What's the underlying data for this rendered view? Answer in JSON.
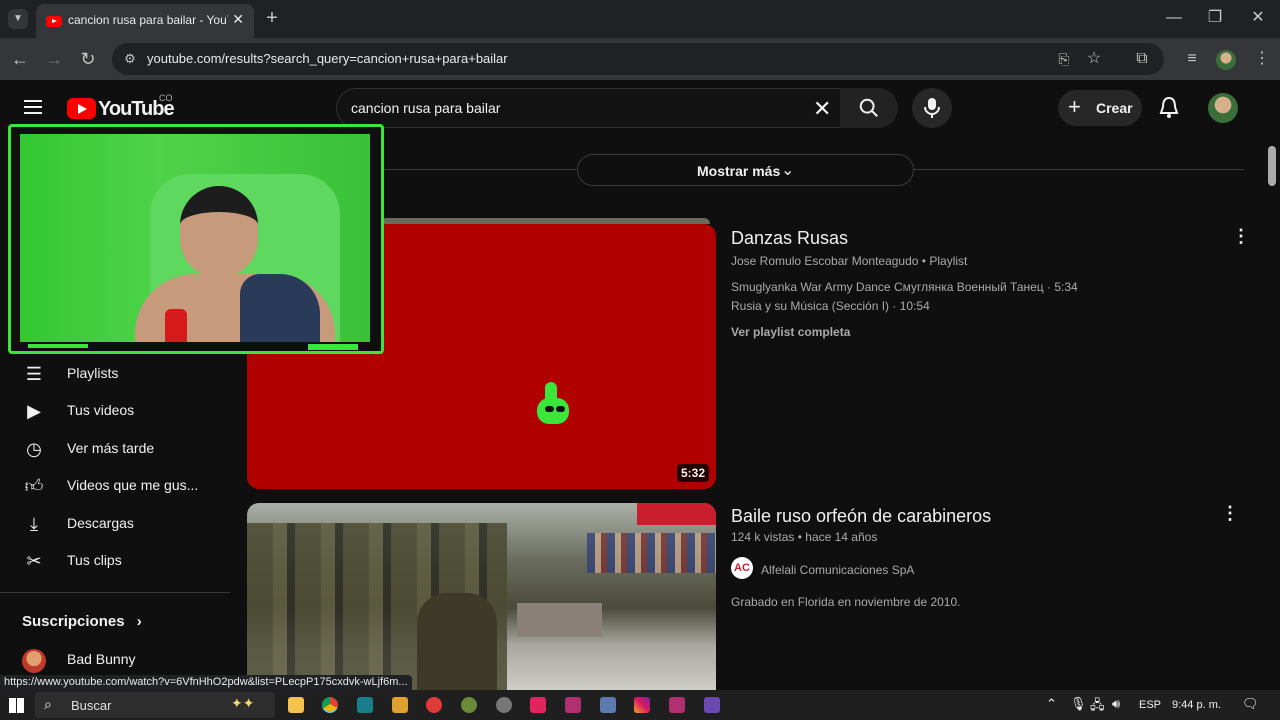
{
  "browser": {
    "tab_title": "cancion rusa para bailar - YouTube",
    "url": "youtube.com/results?search_query=cancion+rusa+para+bailar",
    "status_url": "https://www.youtube.com/watch?v=6VfnHhO2pdw&list=PLecpP175cxdvk-wLjf6m..."
  },
  "youtube": {
    "logo_text": "YouTube",
    "country_code": "CO",
    "search_value": "cancion rusa para bailar",
    "create_label": "Crear",
    "show_more_label": "Mostrar más"
  },
  "sidebar": {
    "items": [
      {
        "label": "Playlists",
        "icon": "playlists-icon"
      },
      {
        "label": "Tus videos",
        "icon": "your-videos-icon"
      },
      {
        "label": "Ver más tarde",
        "icon": "clock-icon"
      },
      {
        "label": "Videos que me gus...",
        "icon": "thumbs-up-icon"
      },
      {
        "label": "Descargas",
        "icon": "download-icon"
      },
      {
        "label": "Tus clips",
        "icon": "scissors-icon"
      }
    ],
    "subscriptions_heading": "Suscripciones",
    "subscriptions": [
      {
        "label": "Bad Bunny"
      }
    ]
  },
  "results": [
    {
      "title": "Danzas Rusas",
      "channel": "Jose Romulo Escobar Monteagudo",
      "type": "Playlist",
      "duration": "5:32",
      "tracks": [
        "Smuglyanka War Army Dance Смуглянка Военный Танец · 5:34",
        "Rusia y su Música (Sección I) · 10:54"
      ],
      "view_full": "Ver playlist completa"
    },
    {
      "title": "Baile ruso orfeón de carabineros",
      "views": "124 k vistas",
      "age": "hace 14 años",
      "channel": "Alfelali Comunicaciones SpA",
      "description": "Grabado en Florida en noviembre de 2010."
    }
  ],
  "taskbar": {
    "search_placeholder": "Buscar",
    "language": "ESP",
    "time": "9:44 p. m."
  },
  "colors": {
    "yt_red": "#ff0000",
    "thumb_red": "#b00000",
    "cam_green": "#39e639",
    "background": "#0f0f0f"
  }
}
